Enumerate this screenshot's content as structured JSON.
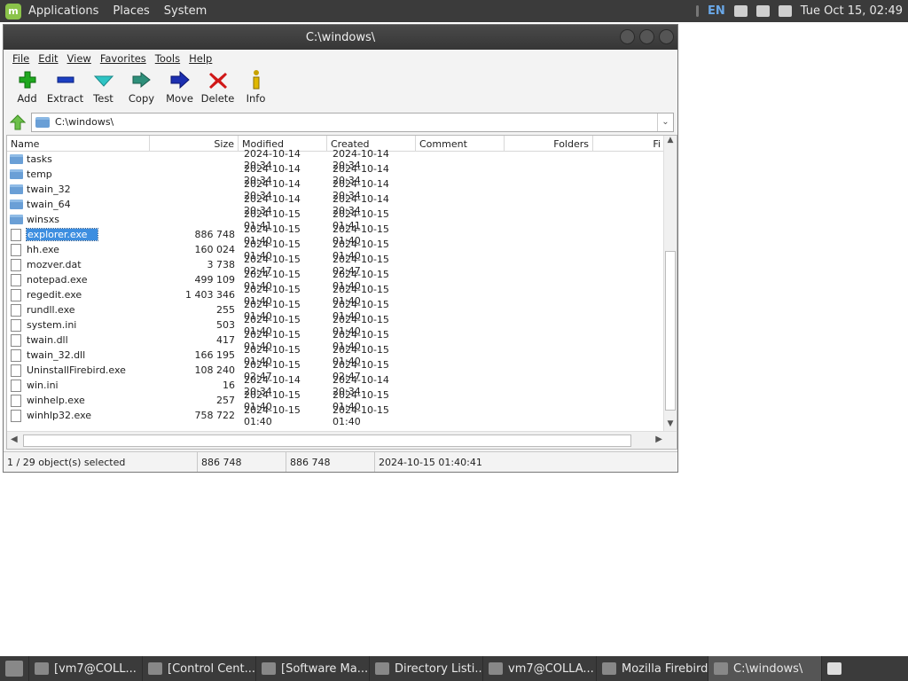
{
  "topbar": {
    "menus": [
      "Applications",
      "Places",
      "System"
    ],
    "keyboard_layout": "EN",
    "clock": "Tue Oct 15, 02:49"
  },
  "window": {
    "title": "C:\\windows\\",
    "menu": [
      "File",
      "Edit",
      "View",
      "Favorites",
      "Tools",
      "Help"
    ],
    "toolbar": [
      {
        "label": "Add",
        "icon": "plus-icon",
        "color": "#1fa81f"
      },
      {
        "label": "Extract",
        "icon": "minus-icon",
        "color": "#1c3fc2"
      },
      {
        "label": "Test",
        "icon": "check-icon",
        "color": "#2ec4c4"
      },
      {
        "label": "Copy",
        "icon": "double-arrow-icon",
        "color": "#2e8f7a"
      },
      {
        "label": "Move",
        "icon": "arrow-right-icon",
        "color": "#1c2fb0"
      },
      {
        "label": "Delete",
        "icon": "x-icon",
        "color": "#d01818"
      },
      {
        "label": "Info",
        "icon": "info-icon",
        "color": "#c8a200"
      }
    ],
    "address": "C:\\windows\\",
    "columns": {
      "name": "Name",
      "size": "Size",
      "modified": "Modified",
      "created": "Created",
      "comment": "Comment",
      "folders": "Folders",
      "files": "Fi"
    },
    "rows": [
      {
        "type": "folder",
        "name": "tasks",
        "size": "",
        "modified": "2024-10-14 20:34",
        "created": "2024-10-14 20:34"
      },
      {
        "type": "folder",
        "name": "temp",
        "size": "",
        "modified": "2024-10-14 20:34",
        "created": "2024-10-14 20:34"
      },
      {
        "type": "folder",
        "name": "twain_32",
        "size": "",
        "modified": "2024-10-14 20:34",
        "created": "2024-10-14 20:34"
      },
      {
        "type": "folder",
        "name": "twain_64",
        "size": "",
        "modified": "2024-10-14 20:34",
        "created": "2024-10-14 20:34"
      },
      {
        "type": "folder",
        "name": "winsxs",
        "size": "",
        "modified": "2024-10-15 01:41",
        "created": "2024-10-15 01:41"
      },
      {
        "type": "file",
        "name": "explorer.exe",
        "size": "886 748",
        "modified": "2024-10-15 01:40",
        "created": "2024-10-15 01:40",
        "selected": true
      },
      {
        "type": "file",
        "name": "hh.exe",
        "size": "160 024",
        "modified": "2024-10-15 01:40",
        "created": "2024-10-15 01:40"
      },
      {
        "type": "file",
        "name": "mozver.dat",
        "size": "3 738",
        "modified": "2024-10-15 02:47",
        "created": "2024-10-15 02:47"
      },
      {
        "type": "file",
        "name": "notepad.exe",
        "size": "499 109",
        "modified": "2024-10-15 01:40",
        "created": "2024-10-15 01:40"
      },
      {
        "type": "file",
        "name": "regedit.exe",
        "size": "1 403 346",
        "modified": "2024-10-15 01:40",
        "created": "2024-10-15 01:40"
      },
      {
        "type": "file",
        "name": "rundll.exe",
        "size": "255",
        "modified": "2024-10-15 01:40",
        "created": "2024-10-15 01:40"
      },
      {
        "type": "file",
        "name": "system.ini",
        "size": "503",
        "modified": "2024-10-15 01:40",
        "created": "2024-10-15 01:40"
      },
      {
        "type": "file",
        "name": "twain.dll",
        "size": "417",
        "modified": "2024-10-15 01:40",
        "created": "2024-10-15 01:40"
      },
      {
        "type": "file",
        "name": "twain_32.dll",
        "size": "166 195",
        "modified": "2024-10-15 01:40",
        "created": "2024-10-15 01:40"
      },
      {
        "type": "file",
        "name": "UninstallFirebird.exe",
        "size": "108 240",
        "modified": "2024-10-15 02:47",
        "created": "2024-10-15 02:47"
      },
      {
        "type": "file",
        "name": "win.ini",
        "size": "16",
        "modified": "2024-10-14 20:34",
        "created": "2024-10-14 20:34"
      },
      {
        "type": "file",
        "name": "winhelp.exe",
        "size": "257",
        "modified": "2024-10-15 01:40",
        "created": "2024-10-15 01:40"
      },
      {
        "type": "file",
        "name": "winhlp32.exe",
        "size": "758 722",
        "modified": "2024-10-15 01:40",
        "created": "2024-10-15 01:40"
      }
    ],
    "status": {
      "selection": "1 / 29 object(s) selected",
      "size": "886 748",
      "packed": "886 748",
      "date": "2024-10-15 01:40:41"
    }
  },
  "taskbar": [
    {
      "label": "[vm7@COLL...",
      "icon": "terminal-icon",
      "active": false
    },
    {
      "label": "[Control Cent...",
      "icon": "control-center-icon",
      "active": false
    },
    {
      "label": "[Software Ma...",
      "icon": "software-manager-icon",
      "active": false
    },
    {
      "label": "Directory Listi...",
      "icon": "chrome-icon",
      "active": false
    },
    {
      "label": "vm7@COLLA...",
      "icon": "terminal-icon",
      "active": false
    },
    {
      "label": "Mozilla Firebird",
      "icon": "firebird-icon",
      "active": false
    },
    {
      "label": "C:\\windows\\",
      "icon": "7zip-icon",
      "active": true
    }
  ]
}
